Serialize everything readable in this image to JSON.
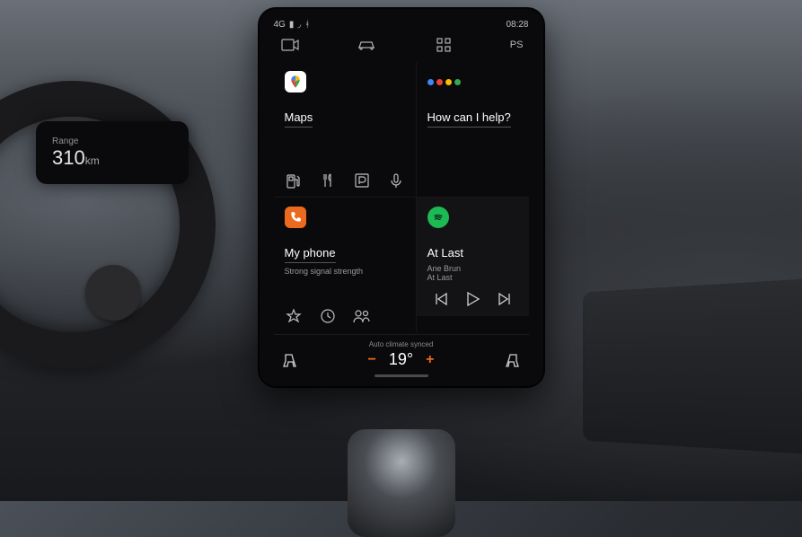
{
  "cluster": {
    "range_label": "Range",
    "range_value": "310",
    "range_unit": "km"
  },
  "status": {
    "network": "4G",
    "signal_icon": "signal",
    "wifi_icon": "wifi",
    "bt_icon": "bluetooth",
    "time": "08:28"
  },
  "nav": {
    "profile": "PS"
  },
  "tiles": {
    "maps": {
      "title": "Maps",
      "actions": [
        "fuel-station",
        "restaurant",
        "parking",
        "voice-search"
      ]
    },
    "assistant": {
      "title": "How can I help?"
    },
    "phone": {
      "title": "My phone",
      "subtitle": "Strong signal strength",
      "actions": [
        "favorites",
        "recents",
        "contacts"
      ]
    },
    "media": {
      "app": "Spotify",
      "track": "At Last",
      "artist": "Ane Brun",
      "album": "At Last"
    }
  },
  "climate": {
    "label": "Auto climate synced",
    "temp_value": "19°",
    "minus": "−",
    "plus": "+"
  }
}
